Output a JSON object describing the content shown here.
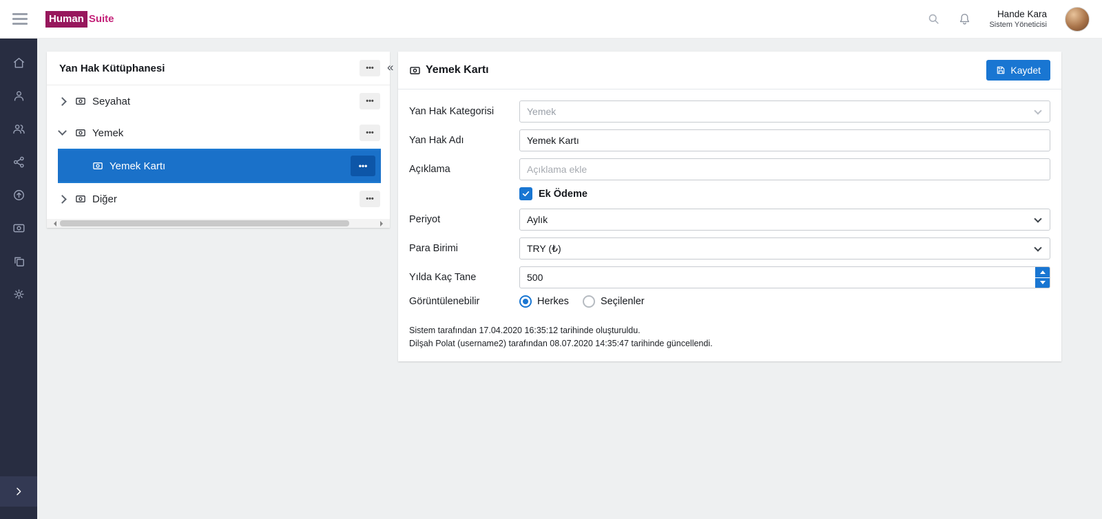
{
  "icons": {
    "more": "•••",
    "collapse": "«"
  },
  "header": {
    "logo_primary": "Human",
    "logo_secondary": "Suite",
    "user_name": "Hande Kara",
    "user_role": "Sistem Yöneticisi"
  },
  "tree_panel": {
    "title": "Yan Hak Kütüphanesi",
    "items": [
      {
        "label": "Seyahat",
        "state": "collapsed"
      },
      {
        "label": "Yemek",
        "state": "expanded"
      },
      {
        "label": "Yemek Kartı",
        "state": "selected"
      },
      {
        "label": "Diğer",
        "state": "collapsed"
      }
    ]
  },
  "form_panel": {
    "title": "Yemek Kartı",
    "save_label": "Kaydet",
    "category_label": "Yan Hak Kategorisi",
    "category_value": "Yemek",
    "name_label": "Yan Hak Adı",
    "name_value": "Yemek Kartı",
    "description_label": "Açıklama",
    "description_placeholder": "Açıklama ekle",
    "extra_payment_label": "Ek Ödeme",
    "extra_payment_checked": true,
    "period_label": "Periyot",
    "period_value": "Aylık",
    "currency_label": "Para Birimi",
    "currency_value": "TRY (₺)",
    "per_year_label": "Yılda Kaç Tane",
    "per_year_value": "500",
    "visibility_label": "Görüntülenebilir",
    "visibility_options": [
      {
        "label": "Herkes",
        "selected": true
      },
      {
        "label": "Seçilenler",
        "selected": false
      }
    ],
    "audit_line1": "Sistem tarafından 17.04.2020 16:35:12 tarihinde oluşturuldu.",
    "audit_line2": "Dilşah Polat (username2) tarafından 08.07.2020 14:35:47 tarihinde güncellendi."
  },
  "colors": {
    "accent": "#1976d2",
    "selected_row": "#1a71c9",
    "selected_row_button": "#0d56a8",
    "brand_box": "#97175c",
    "brand_text": "#c42279",
    "sidebar_bg": "#282d41",
    "content_bg": "#eef0f1"
  }
}
